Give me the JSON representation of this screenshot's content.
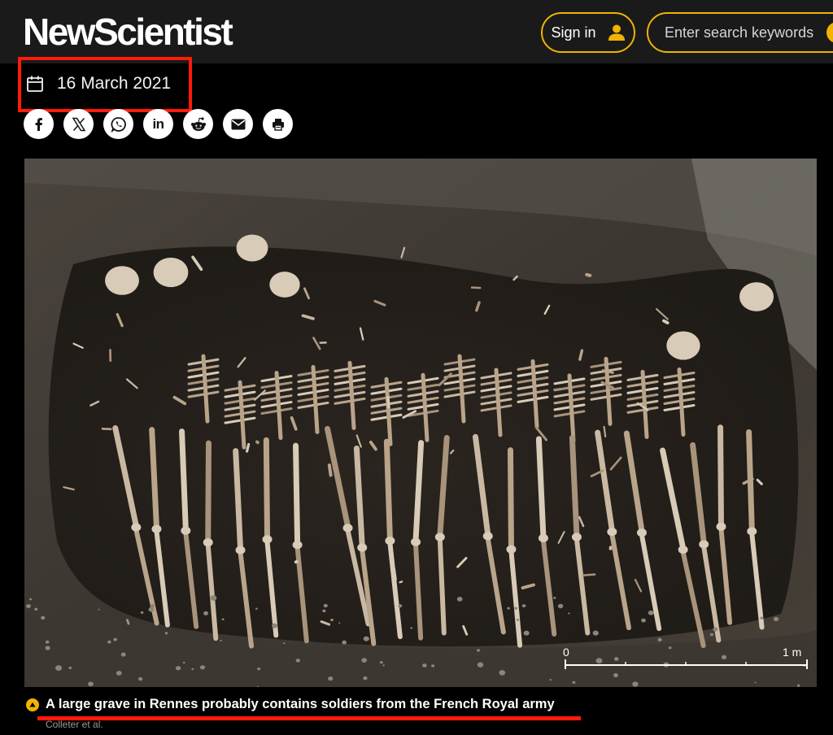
{
  "header": {
    "logo": "NewScientist",
    "signin_label": "Sign in",
    "search_placeholder": "Enter search keywords"
  },
  "article": {
    "date": "16 March 2021",
    "share_icons": [
      "facebook-icon",
      "x-icon",
      "whatsapp-icon",
      "linkedin-icon",
      "reddit-icon",
      "email-icon",
      "print-icon"
    ],
    "image": {
      "scale_start": "0",
      "scale_end": "1 m"
    },
    "caption": "A large grave in Rennes probably contains soldiers from the French Royal army",
    "credit": "Colleter et al."
  },
  "colors": {
    "accent": "#f0b400",
    "annotation": "#ff1a0a",
    "header_bg": "#1a1a1a"
  }
}
